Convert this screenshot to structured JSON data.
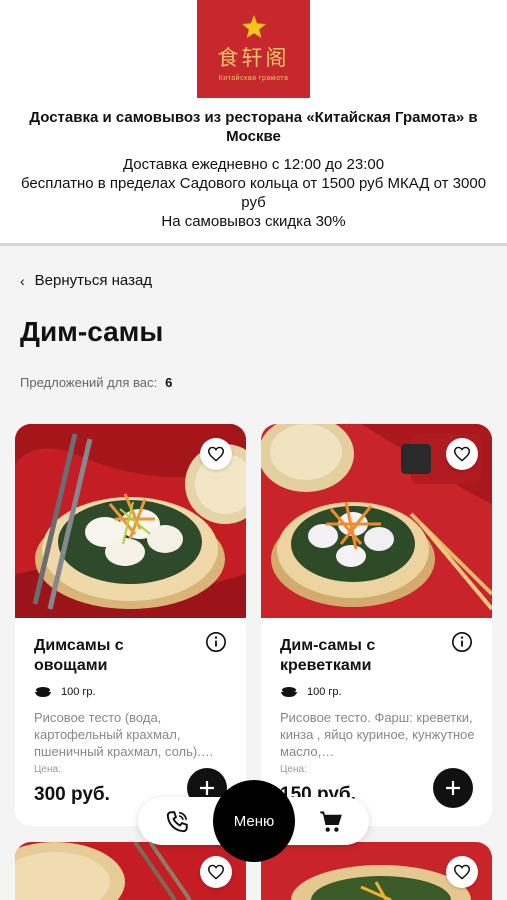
{
  "header": {
    "logo_chinese": "食轩阁",
    "logo_subtitle": "Китайская грамота",
    "title": "Доставка и самовывоз из ресторана «Китайская Грамота» в Москве",
    "info_lines": [
      "Доставка ежедневно с 12:00 до 23:00",
      "бесплатно в пределах Садового кольца от 1500 руб МКАД от 3000 руб",
      "На самовывоз скидка 30%"
    ],
    "brand_color": "#c7282e"
  },
  "nav": {
    "back_label": "Вернуться назад",
    "page_title": "Дим-самы",
    "offers_label": "Предложений для вас:",
    "offers_count": "6"
  },
  "products": [
    {
      "name": "Димсамы с овощами",
      "weight": "100 гр.",
      "description": "Рисовое тесто (вода, картофельный крахмал, пшеничный крахмал, соль).…",
      "price_label": "Цена:",
      "price": "300 руб."
    },
    {
      "name": "Дим-самы с креветками",
      "weight": "100 гр.",
      "description": "Рисовое тесто. Фарш: креветки, кинза , яйцо куриное, кунжутное масло,…",
      "price_label": "Цена:",
      "price": "150 руб."
    }
  ],
  "bottom_nav": {
    "menu_label": "Меню",
    "icons": [
      "phone-icon",
      "cart-icon"
    ]
  }
}
